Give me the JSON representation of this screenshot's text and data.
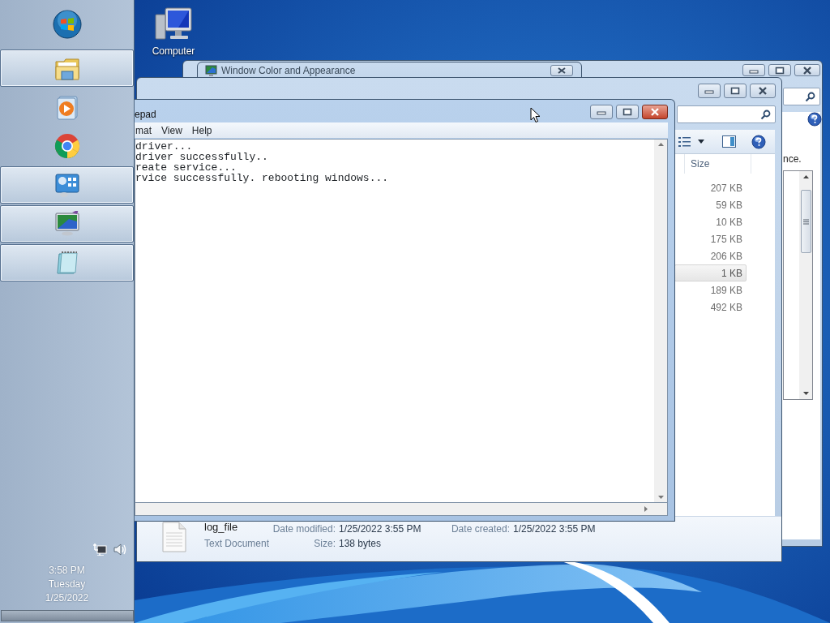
{
  "taskbar": {
    "items": [
      {
        "kind": "explorer",
        "open": true
      },
      {
        "kind": "media-player",
        "open": false
      },
      {
        "kind": "chrome",
        "open": false
      },
      {
        "kind": "control-panel",
        "open": true
      },
      {
        "kind": "display",
        "open": true
      },
      {
        "kind": "notepad",
        "open": true
      }
    ],
    "tray": {
      "time": "3:58 PM",
      "day": "Tuesday",
      "date": "1/25/2022"
    }
  },
  "desktop_icons": [
    {
      "label": "Computer"
    }
  ],
  "control_panel": {
    "text": "nce."
  },
  "appearance_window": {
    "title": "Window Color and Appearance"
  },
  "explorer": {
    "column_header": "Size",
    "files": [
      {
        "size": "207 KB",
        "selected": false
      },
      {
        "size": "59 KB",
        "selected": false
      },
      {
        "size": "10 KB",
        "selected": false
      },
      {
        "size": "175 KB",
        "selected": false
      },
      {
        "size": "206 KB",
        "selected": false
      },
      {
        "size": "1 KB",
        "selected": true
      },
      {
        "size": "189 KB",
        "selected": false
      },
      {
        "size": "492 KB",
        "selected": false
      }
    ],
    "details": {
      "name": "log_file",
      "type": "Text Document",
      "date_modified_label": "Date modified:",
      "date_modified": "1/25/2022 3:55 PM",
      "date_created_label": "Date created:",
      "date_created": "1/25/2022 3:55 PM",
      "size_label": "Size:",
      "size": "138 bytes"
    }
  },
  "notepad": {
    "title": "epad",
    "menu": [
      "mat",
      "View",
      "Help"
    ],
    "lines": [
      "driver...",
      "driver successfully..",
      "reate service...",
      "rvice successfully. rebooting windows..."
    ]
  }
}
